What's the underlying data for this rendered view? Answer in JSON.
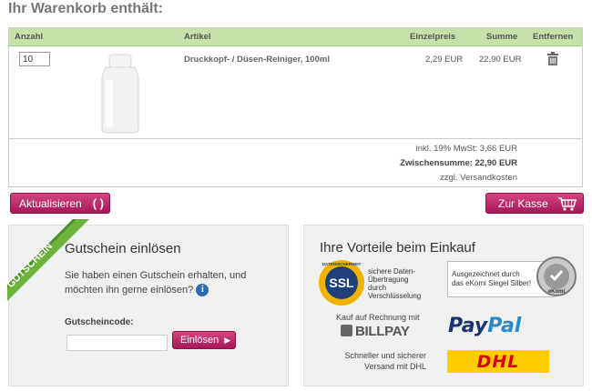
{
  "page": {
    "title": "Ihr Warenkorb enthält:"
  },
  "cart": {
    "headers": {
      "quantity": "Anzahl",
      "article": "Artikel",
      "unit_price": "Einzelpreis",
      "sum": "Summe",
      "remove": "Entfernen"
    },
    "items": [
      {
        "quantity": "10",
        "name": "Druckkopf- / Düsen-Reiniger, 100ml",
        "unit_price": "2,29 EUR",
        "sum": "22,90 EUR",
        "remove_icon": "trash-icon"
      }
    ],
    "tax_line": "inkl. 19% MwSt: 3,66 EUR",
    "subtotal_line": "Zwischensumme: 22,90 EUR",
    "shipping_line": "zzgl. Versandkosten"
  },
  "actions": {
    "update_label": "Aktualisieren",
    "update_glyph": "( )",
    "checkout_label": "Zur Kasse"
  },
  "voucher": {
    "ribbon": "GUTSCHEIN",
    "title": "Gutschein einlösen",
    "text": "Sie haben einen Gutschein erhalten, und möchten ihn gerne einlösen?",
    "info_icon": "i",
    "code_label": "Gutscheincode:",
    "code_value": "",
    "redeem_label": "Einlösen"
  },
  "benefits": {
    "title": "Ihre Vorteile beim Einkauf",
    "ssl_badge": "SSL",
    "ssl_ring_text": "DATENSICHERHEIT",
    "ssl_text": "sichere Daten-Übertragung durch Verschlüsselung",
    "ekomi_text": "Ausgezeichnet durch das eKomi Siegel Silber!",
    "ekomi_seal_text": "eKomi",
    "billpay_label": "Kauf auf Rechnung mit",
    "billpay_logo": "BILLPAY",
    "paypal_part1": "Pay",
    "paypal_part2": "Pal",
    "dhl_label": "Schneller und sicherer Versand mit DHL",
    "dhl_logo": "DHL"
  },
  "colors": {
    "accent_pink": "#b8206a",
    "header_green": "#c6e0a9",
    "voucher_green": "#6cb33e"
  }
}
